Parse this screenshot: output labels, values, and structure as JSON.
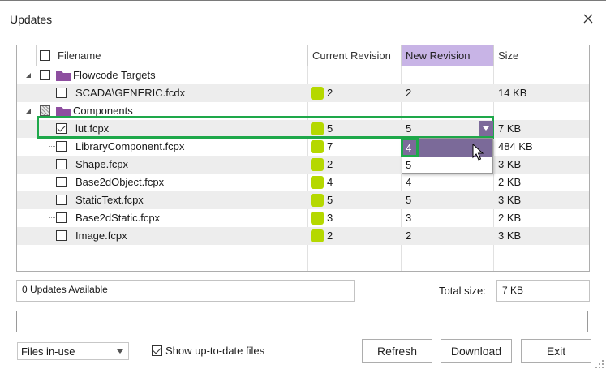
{
  "window": {
    "title": "Updates"
  },
  "columns": {
    "filename": "Filename",
    "current": "Current Revision",
    "new": "New Revision",
    "size": "Size"
  },
  "tree": {
    "group1": {
      "label": "Flowcode Targets"
    },
    "group1_rows": [
      {
        "name": "SCADA\\GENERIC.fcdx",
        "current": "2",
        "new": "2",
        "size": "14 KB"
      }
    ],
    "group2": {
      "label": "Components"
    },
    "group2_rows": [
      {
        "name": "lut.fcpx",
        "current": "5",
        "new": "5",
        "size": "7 KB"
      },
      {
        "name": "LibraryComponent.fcpx",
        "current": "7",
        "new": "",
        "size": "484 KB"
      },
      {
        "name": "Shape.fcpx",
        "current": "2",
        "new": "",
        "size": "3 KB"
      },
      {
        "name": "Base2dObject.fcpx",
        "current": "4",
        "new": "4",
        "size": "2 KB"
      },
      {
        "name": "StaticText.fcpx",
        "current": "5",
        "new": "5",
        "size": "3 KB"
      },
      {
        "name": "Base2dStatic.fcpx",
        "current": "3",
        "new": "3",
        "size": "2 KB"
      },
      {
        "name": "Image.fcpx",
        "current": "2",
        "new": "2",
        "size": "3 KB"
      }
    ]
  },
  "dropdown": {
    "options": [
      "4",
      "5"
    ]
  },
  "status": {
    "updates_text": "0 Updates Available",
    "total_label": "Total size:",
    "total_value": "7 KB"
  },
  "footer": {
    "filter_value": "Files in-use",
    "show_uptodate_label": "Show up-to-date files",
    "refresh_label": "Refresh",
    "download_label": "Download",
    "exit_label": "Exit"
  },
  "colors": {
    "accent": "#7b6a99",
    "header_highlight": "#c8b4e6",
    "revision_marker": "#b5d800",
    "annotation_green": "#1ea84a",
    "folder": "#8e4fa0"
  }
}
